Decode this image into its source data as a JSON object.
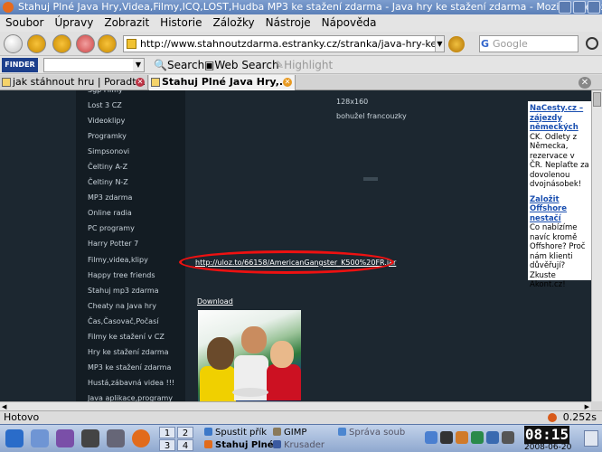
{
  "window": {
    "title": "Stahuj Plné Java Hry,Videa,Filmy,ICQ,LOST,Hudba MP3 ke stažení zdarma - Java hry ke stažení zdarma - Mozilla Firefox"
  },
  "menu": [
    "Soubor",
    "Úpravy",
    "Zobrazit",
    "Historie",
    "Záložky",
    "Nástroje",
    "Nápověda"
  ],
  "nav": {
    "url": "http://www.stahnoutzdarma.estranky.cz/stranka/java-hry-ke-staze",
    "search_placeholder": "Google"
  },
  "toolbar2": {
    "finder": "FINDER",
    "search": "Search",
    "web_search": "Web Search",
    "highlight": "Highlight"
  },
  "tabs": [
    {
      "label": "jak stáhnout hru | Poradt..."
    },
    {
      "label": "Stahuj Plné Java Hry,..."
    }
  ],
  "sidebar": [
    "Sgp Filmy",
    "Lost 3 CZ",
    "Videoklipy",
    "Programky",
    "Simpsonovi",
    "Čeltiny A-Z",
    "Čeltiny N-Z",
    "MP3 zdarma",
    "Online radia",
    "PC programy",
    "Harry Potter 7",
    "Filmy,videa,klipy",
    "Happy tree friends",
    "Stahuj mp3 zdarma",
    "Cheaty na Java hry",
    "Čas,Časovač,Počasí",
    "Filmy ke stažení v CZ",
    "Hry ke stažení zdarma",
    "MP3 ke stažení zdarma",
    "Hustá,zábavná videa !!!",
    "Java aplikace,programy"
  ],
  "content": {
    "resolution": "128x160",
    "note": "bohužel francouzky",
    "link": "http://uloz.to/66158/AmericanGangster_K500%20FR.jar",
    "download": "Download"
  },
  "ad": {
    "title1": "NaCesty.cz – zájezdy německých",
    "text1": "CK. Odlety z Německa, rezervace v ČR. Neplaťte za dovolenou dvojnásobek!",
    "title2": "Založit Offshore nestačí",
    "text2": "Co nabízíme navíc kromě Offshore? Proč nám klienti důvěřují? Zkuste Akont.cz!"
  },
  "status": {
    "text": "Hotovo",
    "time": "0.252s"
  },
  "taskbar": {
    "pager": [
      "1",
      "2",
      "3",
      "4"
    ],
    "tasks": [
      "Spustit přík",
      "GIMP",
      "Správa soub",
      "Stahuj Plné",
      "Krusader"
    ],
    "clock": "08:15",
    "date": "2008-06-20"
  }
}
